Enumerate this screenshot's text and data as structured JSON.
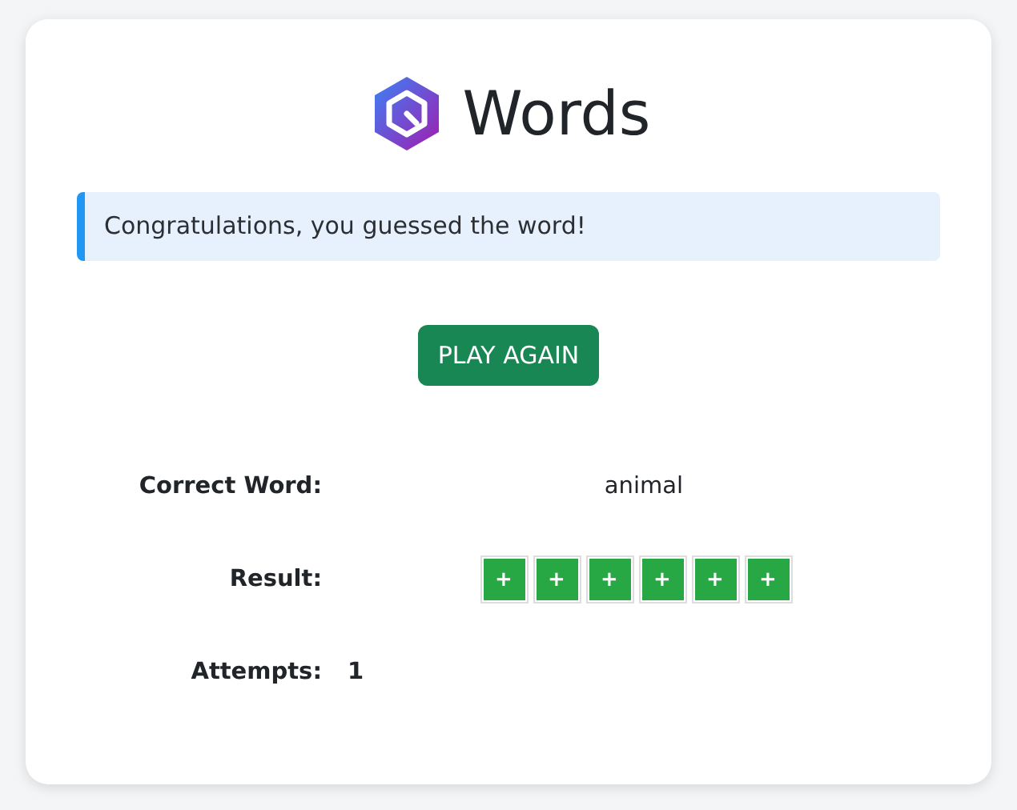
{
  "title": "Words",
  "alert": "Congratulations, you guessed the word!",
  "button": "PLAY AGAIN",
  "rows": [
    {
      "kind": "text",
      "label": "Correct Word:",
      "value": "animal"
    },
    {
      "kind": "tiles",
      "label": "Result:",
      "tiles": [
        {
          "text": "+",
          "color": "#28a745"
        },
        {
          "text": "+",
          "color": "#28a745"
        },
        {
          "text": "+",
          "color": "#28a745"
        },
        {
          "text": "+",
          "color": "#28a745"
        },
        {
          "text": "+",
          "color": "#28a745"
        },
        {
          "text": "+",
          "color": "#28a745"
        }
      ]
    },
    {
      "kind": "number",
      "label": "Attempts:",
      "value": "1"
    }
  ]
}
